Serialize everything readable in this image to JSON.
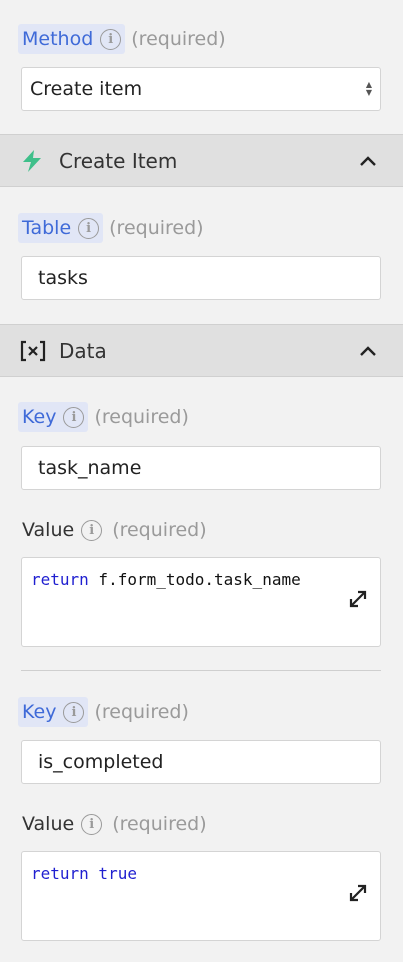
{
  "method": {
    "label": "Method",
    "required": "(required)",
    "selected": "Create item"
  },
  "create_item_section": {
    "title": "Create Item",
    "icon": "bolt-icon",
    "accent": "#3fbf8a"
  },
  "table": {
    "label": "Table",
    "required": "(required)",
    "value": "tasks"
  },
  "data_section": {
    "title": "Data",
    "icon": "variable-icon"
  },
  "pairs": [
    {
      "key_label": "Key",
      "key_required": "(required)",
      "key_value": "task_name",
      "value_label": "Value",
      "value_required": "(required)",
      "code_keyword": "return",
      "code_rest": " f.form_todo.task_name"
    },
    {
      "key_label": "Key",
      "key_required": "(required)",
      "key_value": "is_completed",
      "value_label": "Value",
      "value_required": "(required)",
      "code_keyword": "return",
      "code_rest": " true"
    }
  ],
  "colors": {
    "label_blue": "#3f6ad8",
    "keyword_blue": "#1f1fd0",
    "header_bg": "#e0e0e0"
  }
}
